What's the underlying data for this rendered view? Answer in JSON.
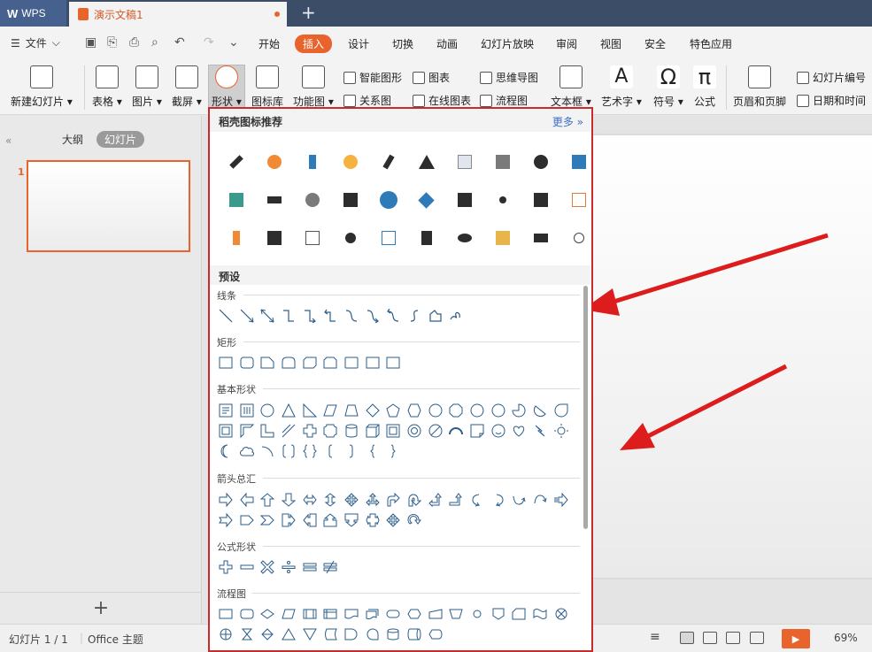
{
  "titlebar": {
    "app_name": "WPS",
    "doc_name": "演示文稿1",
    "new_tab": "+"
  },
  "menu": {
    "file": "文件",
    "tabs": [
      "开始",
      "插入",
      "设计",
      "切换",
      "动画",
      "幻灯片放映",
      "审阅",
      "视图",
      "安全",
      "特色应用"
    ],
    "active_tab": "插入"
  },
  "ribbon": {
    "new_slide": "新建幻灯片",
    "table": "表格",
    "picture": "图片",
    "screenshot": "截屏",
    "shapes": "形状",
    "icon_lib": "图标库",
    "function_chart": "功能图",
    "smart_graphic": "智能图形",
    "chart": "图表",
    "mind_map": "思维导图",
    "relation_chart": "关系图",
    "online_chart": "在线图表",
    "flowchart": "流程图",
    "textbox": "文本框",
    "art_text": "艺术字",
    "symbol": "符号",
    "formula": "公式",
    "header_footer": "页眉和页脚",
    "slide_number": "幻灯片编号",
    "date_time": "日期和时间"
  },
  "left_panel": {
    "tab_outline": "大纲",
    "tab_slides": "幻灯片",
    "slide_number": "1",
    "add_icon": "+"
  },
  "status": {
    "slide_info": "幻灯片 1 / 1",
    "theme": "Office 主题",
    "zoom": "69%"
  },
  "dropdown": {
    "header": "稻壳图标推荐",
    "more": "更多",
    "preset_label": "预设",
    "sections": {
      "lines": "线条",
      "rect": "矩形",
      "basic": "基本形状",
      "arrows": "箭头总汇",
      "formula": "公式形状",
      "flowchart": "流程图"
    }
  },
  "colors": {
    "accent": "#e8642c",
    "title_bar": "#3c4d68",
    "highlight_border": "#cc2a2a",
    "annotation_arrow": "#dd1d1d"
  }
}
